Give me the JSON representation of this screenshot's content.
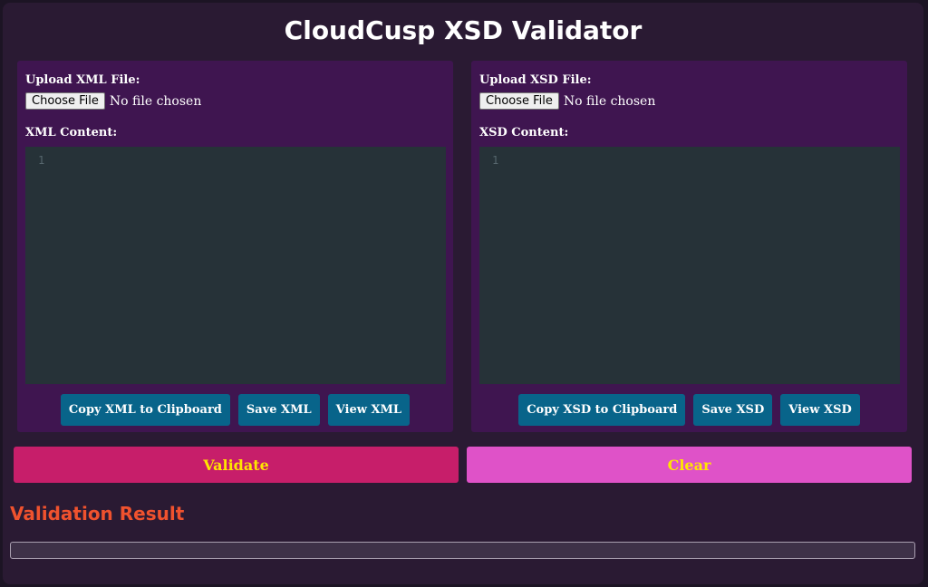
{
  "app": {
    "title": "CloudCusp XSD Validator"
  },
  "xml_panel": {
    "upload_label": "Upload XML File:",
    "choose_file_button": "Choose File",
    "no_file_text": "No file chosen",
    "content_label": "XML Content:",
    "line_number": "1",
    "editor_value": "",
    "copy_button": "Copy XML to Clipboard",
    "save_button": "Save XML",
    "view_button": "View XML"
  },
  "xsd_panel": {
    "upload_label": "Upload XSD File:",
    "choose_file_button": "Choose File",
    "no_file_text": "No file chosen",
    "content_label": "XSD Content:",
    "line_number": "1",
    "editor_value": "",
    "copy_button": "Copy XSD to Clipboard",
    "save_button": "Save XSD",
    "view_button": "View XSD"
  },
  "actions": {
    "validate_button": "Validate",
    "clear_button": "Clear"
  },
  "result": {
    "title": "Validation Result",
    "value": ""
  },
  "colors": {
    "background": "#2a1a33",
    "panel": "#3f1550",
    "editor": "#263238",
    "action_button": "#08648a",
    "validate": "#c71e6a",
    "clear": "#df52c8",
    "button_text": "#ffe600",
    "result_title": "#f0522e"
  }
}
